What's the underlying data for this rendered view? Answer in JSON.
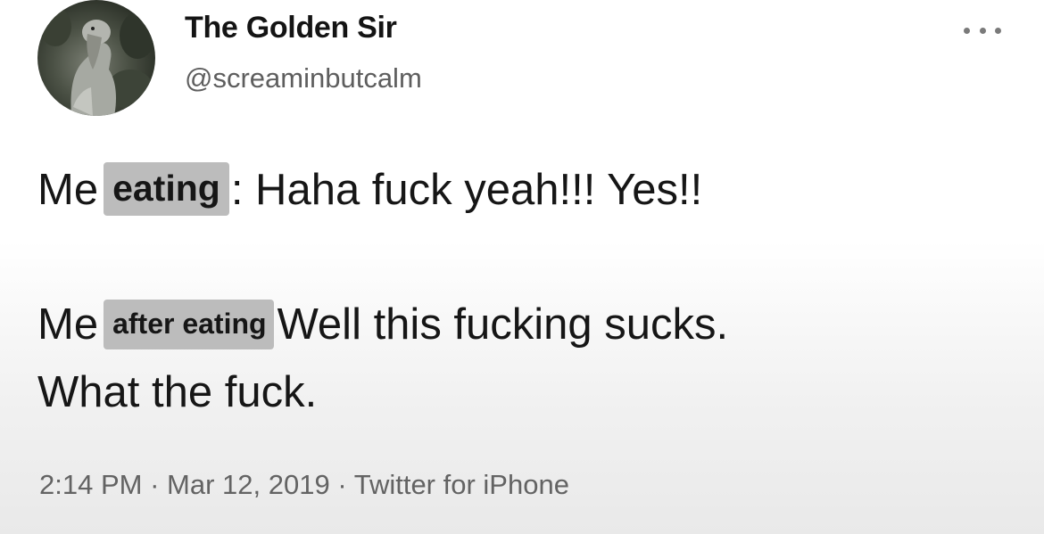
{
  "author": {
    "display_name": "The Golden Sir",
    "handle": "@screaminbutcalm",
    "avatar_icon": "shoebill-bird-avatar"
  },
  "menu": {
    "icon": "more-options-icon"
  },
  "tweet": {
    "line1_prefix": "Me",
    "line1_highlight": "eating",
    "line1_rest": ": Haha fuck yeah!!! Yes!!",
    "line2_prefix": "Me",
    "line2_highlight": "after eating",
    "line2_rest": "Well this fucking sucks.",
    "line3": "What the fuck."
  },
  "meta": {
    "time": "2:14 PM",
    "date": "Mar 12, 2019",
    "source": "Twitter for iPhone",
    "separator": "·"
  },
  "colors": {
    "highlight": "#bcbcbc",
    "text": "#161616",
    "muted": "#636363"
  }
}
